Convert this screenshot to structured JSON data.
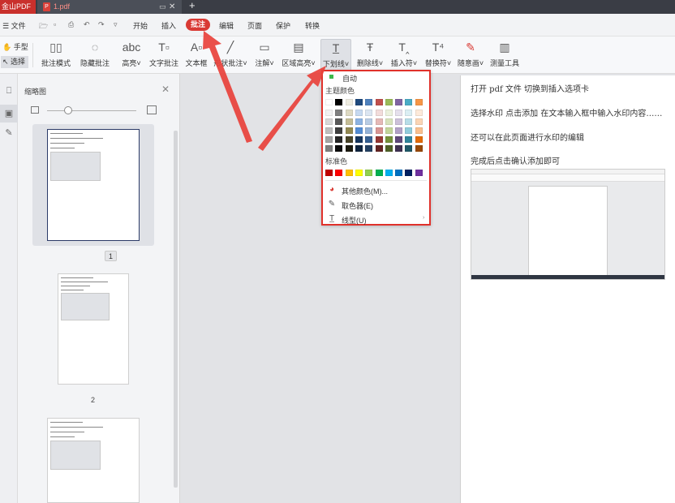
{
  "titlebar": {
    "app_name": "金山PDF",
    "doc_tab": "1.pdf",
    "pdf_icon_label": "P",
    "min_glyph": "▭",
    "close_glyph": "✕",
    "new_tab_glyph": "+"
  },
  "menubar": {
    "file": "☰ 文件",
    "items": [
      "开始",
      "插入",
      "批注",
      "编辑",
      "页面",
      "保护",
      "转换"
    ],
    "active": "批注",
    "quick_access_icons": [
      "open-icon",
      "save-icon",
      "print-icon",
      "undo-icon",
      "redo-icon",
      "more-icon"
    ]
  },
  "toolbar": {
    "hand": "✋ 手型",
    "select": "↖ 选择",
    "tools": [
      {
        "label": "批注模式",
        "icon": "▯▯"
      },
      {
        "label": "隐藏批注",
        "icon": "◌"
      },
      {
        "label": "高亮˅",
        "icon": "abc"
      },
      {
        "label": "文字批注",
        "icon": "T▫"
      },
      {
        "label": "文本框",
        "icon": "A▫"
      },
      {
        "label": "形状批注˅",
        "icon": "╱"
      },
      {
        "label": "注解˅",
        "icon": "▭"
      },
      {
        "label": "区域高亮˅",
        "icon": "▤"
      },
      {
        "label": "下划线˅",
        "icon": "T̲"
      },
      {
        "label": "删除线˅",
        "icon": "Ŧ"
      },
      {
        "label": "插入符˅",
        "icon": "T‸"
      },
      {
        "label": "替换符˅",
        "icon": "T⁴"
      },
      {
        "label": "随意画˅",
        "icon": "✎"
      },
      {
        "label": "测量工具",
        "icon": "▥"
      }
    ]
  },
  "thumbnails": {
    "title": "缩略图",
    "close": "✕",
    "pages": [
      "1",
      "2"
    ],
    "current": "1"
  },
  "document": {
    "lines": [
      "打开 pdf 文件   切换到插入选项卡",
      "选择水印     点击添加   在文本输入框中输入水印内容……",
      "还可以在此页面进行水印的编辑",
      "完成后点击确认添加即可"
    ]
  },
  "dropdown": {
    "auto": "自动",
    "theme_header": "主题颜色",
    "standard_header": "标准色",
    "theme_colors_top": [
      "#ffffff",
      "#000000",
      "#eeece1",
      "#1f497d",
      "#4f81bd",
      "#c0504d",
      "#9bbb59",
      "#8064a2",
      "#4bacc6",
      "#f79646"
    ],
    "theme_shades": [
      [
        "#f2f2f2",
        "#7f7f7f",
        "#ddd9c3",
        "#c6d9f0",
        "#dbe5f1",
        "#f2dcdb",
        "#ebf1dd",
        "#e5e0ec",
        "#dbeef3",
        "#fdeada"
      ],
      [
        "#d8d8d8",
        "#595959",
        "#c4bd97",
        "#8db3e2",
        "#b8cce4",
        "#e5b9b7",
        "#d7e3bc",
        "#ccc1d9",
        "#b7dde8",
        "#fbd5b5"
      ],
      [
        "#bfbfbf",
        "#3f3f3f",
        "#938953",
        "#548dd4",
        "#95b3d7",
        "#d99694",
        "#c3d69b",
        "#b2a2c7",
        "#92cddc",
        "#fac08f"
      ],
      [
        "#a5a5a5",
        "#262626",
        "#494429",
        "#17365d",
        "#366092",
        "#953734",
        "#76923c",
        "#5f497a",
        "#31859b",
        "#e36c09"
      ],
      [
        "#7f7f7f",
        "#0c0c0c",
        "#1d1b10",
        "#0f243e",
        "#244061",
        "#632423",
        "#4f6128",
        "#3f3151",
        "#205867",
        "#974806"
      ]
    ],
    "standard_colors": [
      "#c00000",
      "#ff0000",
      "#ffc000",
      "#ffff00",
      "#92d050",
      "#00b050",
      "#00b0f0",
      "#0070c0",
      "#002060",
      "#7030a0"
    ],
    "more_colors": "其他颜色(M)...",
    "eyedropper": "取色器(E)",
    "line_style": "线型(U)"
  }
}
